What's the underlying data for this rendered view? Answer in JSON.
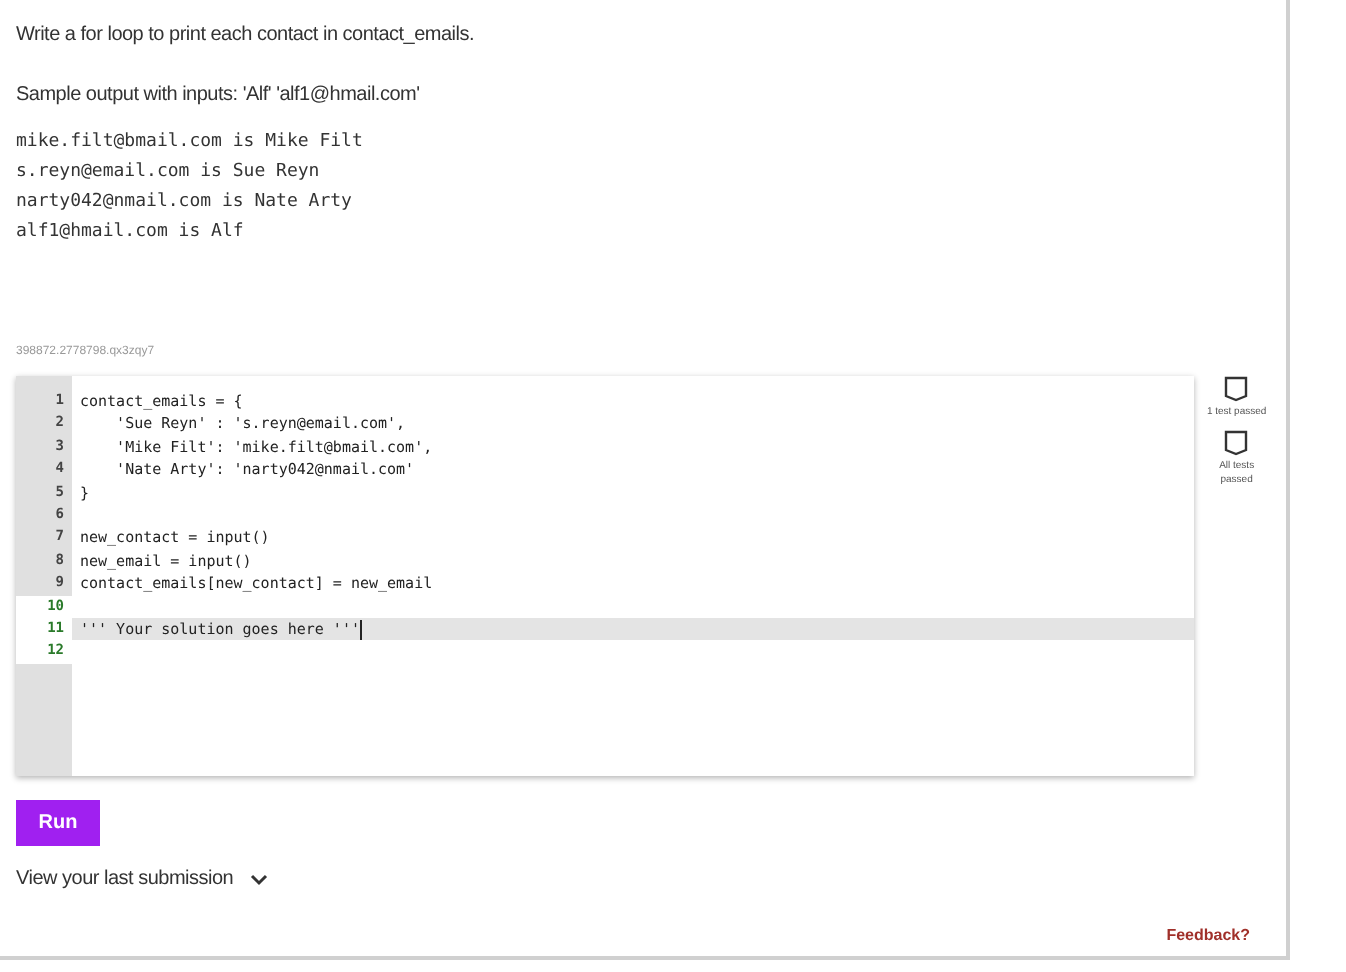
{
  "prompt": "Write a for loop to print each contact in contact_emails.",
  "sample_label": "Sample output with inputs: 'Alf' 'alf1@hmail.com'",
  "sample_output": [
    "mike.filt@bmail.com is Mike Filt",
    "s.reyn@email.com is Sue Reyn",
    "narty042@nmail.com is Nate Arty",
    "alf1@hmail.com is Alf"
  ],
  "exercise_id": "398872.2778798.qx3zqy7",
  "editor": {
    "lines": [
      {
        "number": "1",
        "code": "contact_emails = {",
        "readonly": true,
        "active": false
      },
      {
        "number": "2",
        "code": "    'Sue Reyn' : 's.reyn@email.com',",
        "readonly": true,
        "active": false
      },
      {
        "number": "3",
        "code": "    'Mike Filt': 'mike.filt@bmail.com',",
        "readonly": true,
        "active": false
      },
      {
        "number": "4",
        "code": "    'Nate Arty': 'narty042@nmail.com'",
        "readonly": true,
        "active": false
      },
      {
        "number": "5",
        "code": "}",
        "readonly": true,
        "active": false
      },
      {
        "number": "6",
        "readonly": true,
        "active": false
      },
      {
        "number": "7",
        "code": "new_contact = input()",
        "readonly": true,
        "active": false
      },
      {
        "number": "8",
        "code": "new_email = input()",
        "readonly": true,
        "active": false
      },
      {
        "number": "9",
        "code": "contact_emails[new_contact] = new_email",
        "readonly": true,
        "active": false
      },
      {
        "number": "10",
        "readonly": false,
        "active": false
      },
      {
        "number": "11",
        "code": "''' Your solution goes here '''",
        "readonly": false,
        "active": true
      },
      {
        "number": "12",
        "readonly": false,
        "active": false
      }
    ]
  },
  "tests": [
    {
      "label": "1 test passed",
      "passed": false
    },
    {
      "label": "All tests passed",
      "passed": false
    }
  ],
  "run_button": "Run",
  "last_submission": "View your last submission",
  "feedback_link": "Feedback?"
}
